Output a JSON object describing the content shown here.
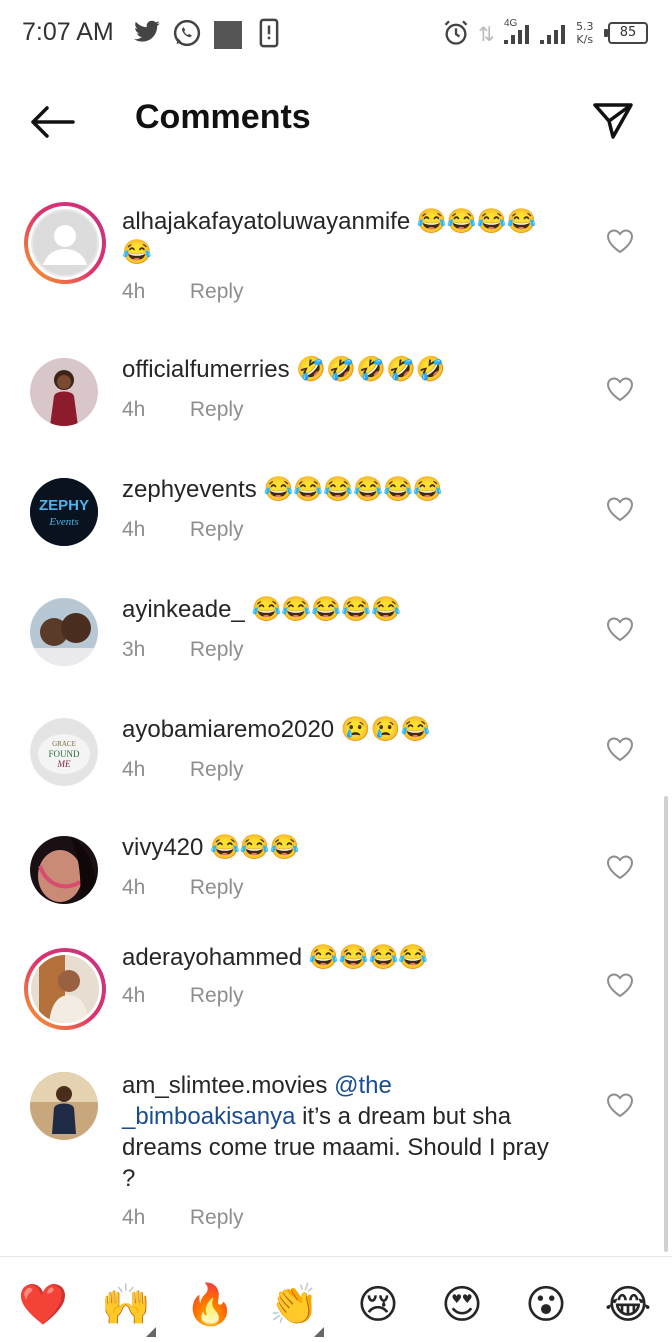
{
  "status_bar": {
    "time": "7:07 AM",
    "network_type": "4G",
    "speed_value": "5.3",
    "speed_unit": "K/s",
    "battery": "85",
    "icons": [
      "twitter-icon",
      "whatsapp-icon",
      "notification-square-icon",
      "phone-alert-icon",
      "alarm-icon",
      "data-arrows-icon",
      "signal-icon",
      "signal-icon"
    ]
  },
  "header": {
    "title": "Comments",
    "back_icon": "arrow-left-icon",
    "share_icon": "send-icon"
  },
  "comments": [
    {
      "username": "alhajakafayatoluwayanmife",
      "text": "😂😂😂😂😂",
      "mention": "",
      "time": "4h",
      "reply": "Reply",
      "story_ring": true
    },
    {
      "username": "officialfumerries",
      "text": "🤣🤣🤣🤣🤣",
      "mention": "",
      "time": "4h",
      "reply": "Reply",
      "story_ring": false
    },
    {
      "username": "zephyevents",
      "text": "😂😂😂😂😂😂",
      "mention": "",
      "time": "4h",
      "reply": "Reply",
      "story_ring": false,
      "avatar_text_1": "ZEPHY",
      "avatar_text_2": "Events"
    },
    {
      "username": "ayinkeade_",
      "text": "😂😂😂😂😂",
      "mention": "",
      "time": "3h",
      "reply": "Reply",
      "story_ring": false
    },
    {
      "username": "ayobamiaremo2020",
      "text": "😢😢😂",
      "mention": "",
      "time": "4h",
      "reply": "Reply",
      "story_ring": false,
      "avatar_text_1": "GRACE",
      "avatar_text_2": "FOUND",
      "avatar_text_3": "ME"
    },
    {
      "username": "vivy420",
      "text": "😂😂😂",
      "mention": "",
      "time": "4h",
      "reply": "Reply",
      "story_ring": false
    },
    {
      "username": "aderayohammed",
      "text": "😂😂😂😂",
      "mention": "",
      "time": "4h",
      "reply": "Reply",
      "story_ring": true
    },
    {
      "username": "am_slimtee.movies",
      "mention": "@the _bimboakisanya",
      "text": "it’s a dream but sha dreams come true maami. Should I pray ?",
      "time": "4h",
      "reply": "Reply",
      "story_ring": false
    }
  ],
  "reactions": [
    "❤️",
    "🙌",
    "🔥",
    "👏",
    "😢",
    "😍",
    "😮",
    "😂"
  ],
  "colors": {
    "text": "#262626",
    "meta": "#8e8e8e",
    "mention": "#1a4c8f",
    "story_ring_start": "#f9a825",
    "story_ring_end": "#c13584"
  }
}
